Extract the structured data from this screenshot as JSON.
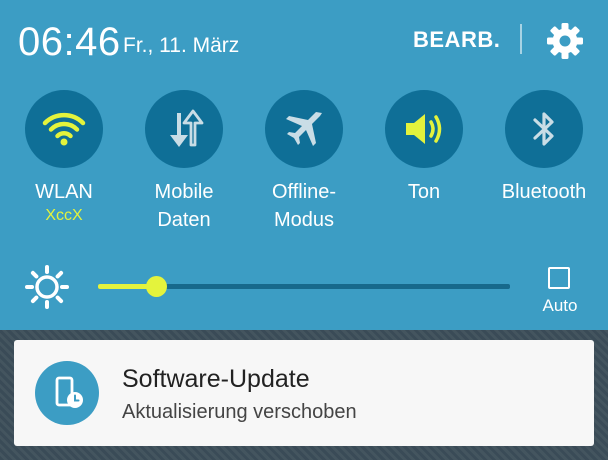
{
  "status_bar": {
    "time": "06:46",
    "date": "Fr., 11. März",
    "edit_label": "BEARB.",
    "settings_icon": "gear-icon"
  },
  "quick_toggles": [
    {
      "id": "wlan",
      "label": "WLAN",
      "sublabel": "XccX",
      "active": true,
      "icon": "wifi-icon"
    },
    {
      "id": "mobile-data",
      "label_line1": "Mobile",
      "label_line2": "Daten",
      "active": false,
      "icon": "data-transfer-icon"
    },
    {
      "id": "offline",
      "label_line1": "Offline-",
      "label_line2": "Modus",
      "active": false,
      "icon": "airplane-icon"
    },
    {
      "id": "sound",
      "label": "Ton",
      "active": true,
      "icon": "speaker-icon"
    },
    {
      "id": "bluetooth",
      "label": "Bluetooth",
      "active": false,
      "icon": "bluetooth-icon"
    }
  ],
  "brightness": {
    "level": 0.14,
    "auto_label": "Auto",
    "auto_checked": false,
    "icon": "brightness-icon"
  },
  "notification": {
    "title": "Software-Update",
    "subtitle": "Aktualisierung verschoben",
    "icon": "software-update-icon"
  },
  "colors": {
    "panel_background": "#3c9dc4",
    "toggle_circle": "#0f6f97",
    "active_accent": "#e4f33c",
    "inactive_icon": "#c9dde6",
    "card_background": "#f7f7f7"
  }
}
